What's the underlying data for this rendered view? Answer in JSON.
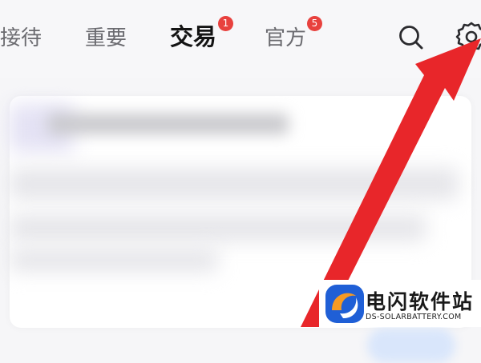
{
  "tabs": [
    {
      "label": "接待",
      "active": false
    },
    {
      "label": "重要",
      "active": false
    },
    {
      "label": "交易",
      "active": true,
      "badge": "1"
    },
    {
      "label": "官方",
      "active": false,
      "badge": "5"
    }
  ],
  "icons": {
    "search": "search-icon",
    "settings": "gear-icon"
  },
  "annotation": {
    "arrow_color": "#e8262a"
  },
  "watermark": {
    "title": "电闪软件站",
    "subtitle": "DS-SOLARBATTERY.COM",
    "logo_colors": [
      "#f59a23",
      "#1f5fd6"
    ]
  },
  "colors": {
    "badge": "#e8413e",
    "active_tab": "#141414",
    "inactive_tab": "#6b6b70"
  }
}
